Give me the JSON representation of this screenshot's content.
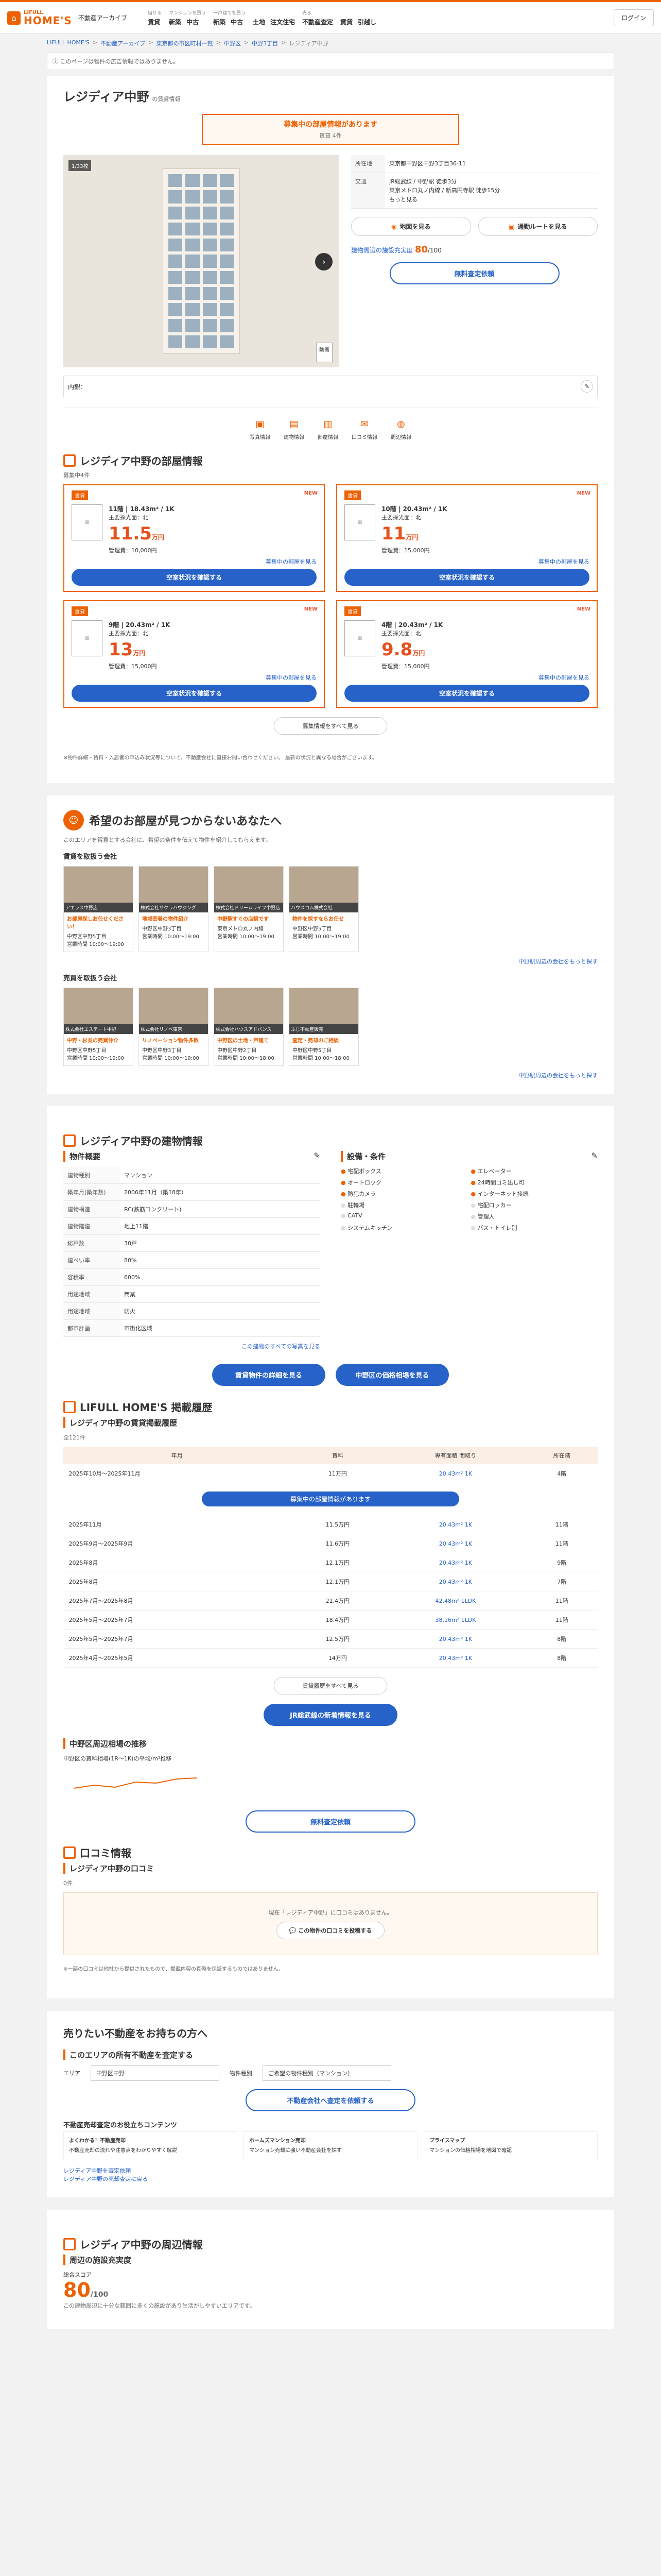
{
  "header": {
    "brand_small": "LIFULL",
    "brand": "HOME'S",
    "archive": "不動産アーカイブ",
    "login": "ログイン",
    "nav": [
      {
        "label": "借りる",
        "items": [
          "賃貸"
        ]
      },
      {
        "label": "マンションを買う",
        "items": [
          "新築",
          "中古"
        ]
      },
      {
        "label": "一戸建てを買う",
        "items": [
          "新築",
          "中古"
        ]
      },
      {
        "label": "",
        "items": [
          "土地",
          "注文住宅"
        ]
      },
      {
        "label": "売る",
        "items": [
          "不動産査定"
        ]
      },
      {
        "label": "",
        "items": [
          "賃貸",
          "引越し"
        ]
      }
    ]
  },
  "breadcrumb": [
    "LIFULL HOME'S",
    "不動産アーカイブ",
    "東京都の市区町村一覧",
    "中野区",
    "中野3丁目",
    "レジディア中野"
  ],
  "notice": "このページは物件の広告情報ではありません。",
  "title": "レジディア中野",
  "title_sub": "の賃貸情報",
  "vacancy": {
    "title": "募集中の部屋情報があります",
    "sub": "賃貸 4件"
  },
  "photo": {
    "count": "1/33枚",
    "video": "動画"
  },
  "info": {
    "rows": [
      {
        "k": "所在地",
        "v": "東京都中野区中野3丁目36-11"
      },
      {
        "k": "交通",
        "v": "JR総武線 / 中野駅 徒歩3分\n東京メトロ丸ノ内線 / 新高円寺駅 徒歩15分\nもっと見る"
      }
    ],
    "map_btn": "地図を見る",
    "route_btn": "通勤ルートを見る",
    "eval_label": "建物周辺の施設充実度",
    "eval_score": "80",
    "eval_unit": "/100",
    "appraisal": "無料査定依頼"
  },
  "memo_label": "内観：",
  "qnav": [
    "写真情報",
    "建物情報",
    "部屋情報",
    "口コミ情報",
    "周辺情報"
  ],
  "rooms_section": {
    "title": "レジディア中野の部屋情報",
    "sub": "募集中4件",
    "rooms": [
      {
        "type": "賃貸",
        "floor": "11階",
        "area": "18.43m²",
        "layout": "1K",
        "dir": "主要採光面：北",
        "price": "11.5",
        "unit": "万円",
        "fee": "管理費：10,000円",
        "link": "募集中の部屋を見る",
        "btn": "空室状況を確認する",
        "new": "NEW"
      },
      {
        "type": "賃貸",
        "floor": "10階",
        "area": "20.43m²",
        "layout": "1K",
        "dir": "主要採光面：北",
        "price": "11",
        "unit": "万円",
        "fee": "管理費：15,000円",
        "link": "募集中の部屋を見る",
        "btn": "空室状況を確認する",
        "new": "NEW"
      },
      {
        "type": "賃貸",
        "floor": "9階",
        "area": "20.43m²",
        "layout": "1K",
        "dir": "主要採光面：北",
        "price": "13",
        "unit": "万円",
        "fee": "管理費：15,000円",
        "link": "募集中の部屋を見る",
        "btn": "空室状況を確認する",
        "new": "NEW"
      },
      {
        "type": "賃貸",
        "floor": "4階",
        "area": "20.43m²",
        "layout": "1K",
        "dir": "主要採光面：北",
        "price": "9.8",
        "unit": "万円",
        "fee": "管理費：15,000円",
        "link": "募集中の部屋を見る",
        "btn": "空室状況を確認する",
        "new": "NEW"
      }
    ],
    "more": "募集情報をすべて見る",
    "note": "※物件詳細・賃料・入居者の申込み状況等について、不動産会社に直接お問い合わせください。 最新の状況と異なる場合がございます。"
  },
  "agents": {
    "title": "希望のお部屋が見つからないあなたへ",
    "desc": "このエリアを得意とする会社に、希望の条件を伝えて物件を紹介してもらえます。",
    "rent_head": "賃貸を取扱う会社",
    "sale_head": "売買を取扱う会社",
    "more": "中野駅周辺の会社をもっと探す",
    "rent": [
      {
        "h": "アエラス中野店",
        "t": "お部屋探しお任せください！",
        "a": "中野区中野5丁目",
        "time": "営業時間 10:00〜19:00"
      },
      {
        "h": "株式会社サクラハウジング",
        "t": "地域密着の物件紹介",
        "a": "中野区中野3丁目",
        "time": "営業時間 10:00〜19:00"
      },
      {
        "h": "株式会社ドリームライフ中野店",
        "t": "中野駅すぐの店舗です",
        "a": "東京メトロ丸ノ内線",
        "time": "営業時間 10:00〜19:00"
      },
      {
        "h": "ハウスコム株式会社",
        "t": "物件を探すならお任せ",
        "a": "中野区中野5丁目",
        "time": "営業時間 10:00〜19:00"
      }
    ],
    "sale": [
      {
        "h": "株式会社エステート中野",
        "t": "中野・杉並の売買仲介",
        "a": "中野区中野5丁目",
        "time": "営業時間 10:00〜19:00"
      },
      {
        "h": "株式会社リノベ東京",
        "t": "リノベーション物件多数",
        "a": "中野区中野3丁目",
        "time": "営業時間 10:00〜19:00"
      },
      {
        "h": "株式会社ハウスアドバンス",
        "t": "中野区の土地・戸建て",
        "a": "中野区中野2丁目",
        "time": "営業時間 10:00〜18:00"
      },
      {
        "h": "ふじ不動産販売",
        "t": "査定・売却のご相談",
        "a": "中野区中野5丁目",
        "time": "営業時間 10:00〜18:00"
      }
    ]
  },
  "building": {
    "title": "レジディア中野の建物情報",
    "overview": "物件概要",
    "features": "設備・条件",
    "rows": [
      {
        "k": "建物種別",
        "v": "マンション"
      },
      {
        "k": "築年月(築年数)",
        "v": "2006年11月（築18年）"
      },
      {
        "k": "建物構造",
        "v": "RC(鉄筋コンクリート)"
      },
      {
        "k": "建物階建",
        "v": "地上11階"
      },
      {
        "k": "総戸数",
        "v": "30戸"
      },
      {
        "k": "建ぺい率",
        "v": "80%"
      },
      {
        "k": "容積率",
        "v": "600%"
      },
      {
        "k": "用途地域",
        "v": "商業"
      },
      {
        "k": "用途地域",
        "v": "防火"
      },
      {
        "k": "都市計画",
        "v": "市街化区域"
      }
    ],
    "feat": [
      "宅配ボックス",
      "エレベーター",
      "オートロック",
      "24時間ゴミ出し可",
      "防犯カメラ",
      "インターネット接続",
      "駐輪場",
      "宅配ロッカー",
      "CATV",
      "管理人",
      "システムキッチン",
      "バス・トイレ別"
    ],
    "more": "この建物のすべての写真を見る",
    "btn1": "賃貸物件の詳細を見る",
    "btn2": "中野区の価格相場を見る"
  },
  "history": {
    "title": "LIFULL HOME'S 掲載履歴",
    "sub": "レジディア中野の賃貸掲載履歴",
    "count": "全121件",
    "cols": [
      "年月",
      "賃料",
      "専有面積 間取り",
      "所在階"
    ],
    "rows": [
      [
        "2025年10月〜2025年11月",
        "11万円",
        "20.43m² 1K",
        "4階"
      ],
      [
        "2025年11月",
        "11.5万円",
        "20.43m² 1K",
        "11階"
      ],
      [
        "2025年9月〜2025年9月",
        "11.6万円",
        "20.43m² 1K",
        "11階"
      ],
      [
        "2025年8月",
        "12.1万円",
        "20.43m² 1K",
        "9階"
      ],
      [
        "2025年8月",
        "12.1万円",
        "20.43m² 1K",
        "7階"
      ],
      [
        "2025年7月〜2025年8月",
        "21.4万円",
        "42.48m² 1LDK",
        "11階"
      ],
      [
        "2025年5月〜2025年7月",
        "18.4万円",
        "38.16m² 1LDK",
        "11階"
      ],
      [
        "2025年5月〜2025年7月",
        "12.5万円",
        "20.43m² 1K",
        "8階"
      ],
      [
        "2025年4月〜2025年5月",
        "14万円",
        "20.43m² 1K",
        "8階"
      ]
    ],
    "vacbar": "募集中の部屋情報があります",
    "more": "賃貸履歴をすべて見る",
    "btn": "JR総武線の新着情報を見る",
    "graph_title": "中野区周辺相場の推移",
    "graph_note": "中野区の賃料相場(1R〜1K)の平均/m²推移",
    "appraisal": "無料査定依頼"
  },
  "reviews": {
    "title": "口コミ情報",
    "sub": "レジディア中野の口コミ",
    "count": "0件",
    "empty": "現在「レジディア中野」に口コミはありません。",
    "btn": "この物件の口コミを投稿する",
    "note": "※一部の口コミは他社から提供されたもので、掲載内容の真偽を保証するものではありません。"
  },
  "sell": {
    "title": "売りたい不動産をお持ちの方へ",
    "sub": "このエリアの所有不動産を査定する",
    "area_label": "エリア",
    "area_value": "中野区中野",
    "type_label": "物件種別",
    "type_value": "ご希望の物件種別（マンション）",
    "btn": "不動産会社へ査定を依頼する",
    "tips_head": "不動産売却査定のお役立ちコンテンツ",
    "tips": [
      {
        "t": "よくわかる！不動産売却",
        "d": "不動産売却の流れや注意点をわかりやすく解説"
      },
      {
        "t": "ホームズマンション売却",
        "d": "マンション売却に強い不動産会社を探す"
      },
      {
        "t": "プライスマップ",
        "d": "マンションの価格相場を地図で確認"
      }
    ],
    "links": [
      "レジディア中野を査定依頼",
      "レジディア中野の売却査定に戻る"
    ]
  },
  "surroundings": {
    "title": "レジディア中野の周辺情報",
    "sub": "周辺の施設充実度",
    "score_label": "総合スコア",
    "score": "80",
    "unit": "/100",
    "note": "この建物周辺に十分な範囲に多くの施設があり生活がしやすいエリアです。"
  }
}
